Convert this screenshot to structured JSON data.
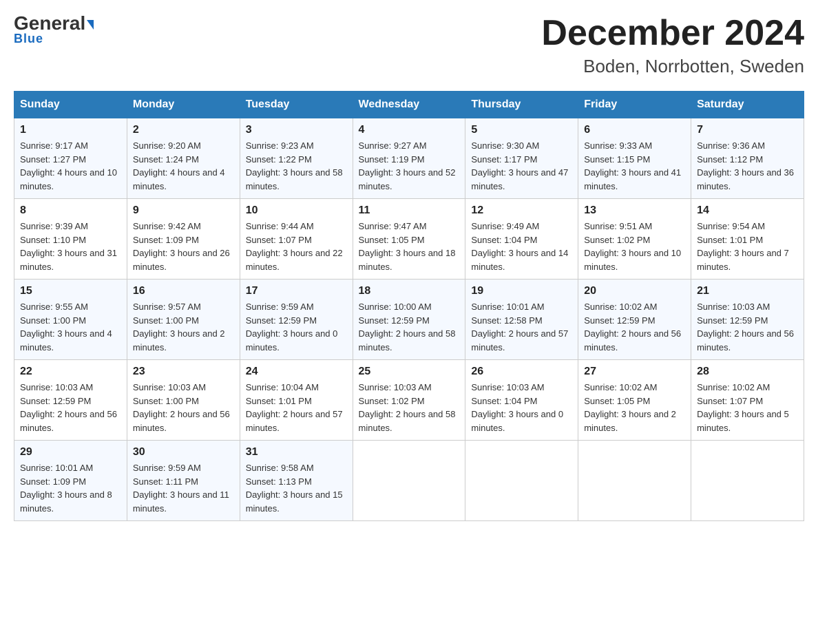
{
  "header": {
    "logo_main": "General",
    "logo_sub": "Blue",
    "month_title": "December 2024",
    "location": "Boden, Norrbotten, Sweden"
  },
  "weekdays": [
    "Sunday",
    "Monday",
    "Tuesday",
    "Wednesday",
    "Thursday",
    "Friday",
    "Saturday"
  ],
  "weeks": [
    [
      {
        "day": "1",
        "sunrise": "9:17 AM",
        "sunset": "1:27 PM",
        "daylight": "4 hours and 10 minutes."
      },
      {
        "day": "2",
        "sunrise": "9:20 AM",
        "sunset": "1:24 PM",
        "daylight": "4 hours and 4 minutes."
      },
      {
        "day": "3",
        "sunrise": "9:23 AM",
        "sunset": "1:22 PM",
        "daylight": "3 hours and 58 minutes."
      },
      {
        "day": "4",
        "sunrise": "9:27 AM",
        "sunset": "1:19 PM",
        "daylight": "3 hours and 52 minutes."
      },
      {
        "day": "5",
        "sunrise": "9:30 AM",
        "sunset": "1:17 PM",
        "daylight": "3 hours and 47 minutes."
      },
      {
        "day": "6",
        "sunrise": "9:33 AM",
        "sunset": "1:15 PM",
        "daylight": "3 hours and 41 minutes."
      },
      {
        "day": "7",
        "sunrise": "9:36 AM",
        "sunset": "1:12 PM",
        "daylight": "3 hours and 36 minutes."
      }
    ],
    [
      {
        "day": "8",
        "sunrise": "9:39 AM",
        "sunset": "1:10 PM",
        "daylight": "3 hours and 31 minutes."
      },
      {
        "day": "9",
        "sunrise": "9:42 AM",
        "sunset": "1:09 PM",
        "daylight": "3 hours and 26 minutes."
      },
      {
        "day": "10",
        "sunrise": "9:44 AM",
        "sunset": "1:07 PM",
        "daylight": "3 hours and 22 minutes."
      },
      {
        "day": "11",
        "sunrise": "9:47 AM",
        "sunset": "1:05 PM",
        "daylight": "3 hours and 18 minutes."
      },
      {
        "day": "12",
        "sunrise": "9:49 AM",
        "sunset": "1:04 PM",
        "daylight": "3 hours and 14 minutes."
      },
      {
        "day": "13",
        "sunrise": "9:51 AM",
        "sunset": "1:02 PM",
        "daylight": "3 hours and 10 minutes."
      },
      {
        "day": "14",
        "sunrise": "9:54 AM",
        "sunset": "1:01 PM",
        "daylight": "3 hours and 7 minutes."
      }
    ],
    [
      {
        "day": "15",
        "sunrise": "9:55 AM",
        "sunset": "1:00 PM",
        "daylight": "3 hours and 4 minutes."
      },
      {
        "day": "16",
        "sunrise": "9:57 AM",
        "sunset": "1:00 PM",
        "daylight": "3 hours and 2 minutes."
      },
      {
        "day": "17",
        "sunrise": "9:59 AM",
        "sunset": "12:59 PM",
        "daylight": "3 hours and 0 minutes."
      },
      {
        "day": "18",
        "sunrise": "10:00 AM",
        "sunset": "12:59 PM",
        "daylight": "2 hours and 58 minutes."
      },
      {
        "day": "19",
        "sunrise": "10:01 AM",
        "sunset": "12:58 PM",
        "daylight": "2 hours and 57 minutes."
      },
      {
        "day": "20",
        "sunrise": "10:02 AM",
        "sunset": "12:59 PM",
        "daylight": "2 hours and 56 minutes."
      },
      {
        "day": "21",
        "sunrise": "10:03 AM",
        "sunset": "12:59 PM",
        "daylight": "2 hours and 56 minutes."
      }
    ],
    [
      {
        "day": "22",
        "sunrise": "10:03 AM",
        "sunset": "12:59 PM",
        "daylight": "2 hours and 56 minutes."
      },
      {
        "day": "23",
        "sunrise": "10:03 AM",
        "sunset": "1:00 PM",
        "daylight": "2 hours and 56 minutes."
      },
      {
        "day": "24",
        "sunrise": "10:04 AM",
        "sunset": "1:01 PM",
        "daylight": "2 hours and 57 minutes."
      },
      {
        "day": "25",
        "sunrise": "10:03 AM",
        "sunset": "1:02 PM",
        "daylight": "2 hours and 58 minutes."
      },
      {
        "day": "26",
        "sunrise": "10:03 AM",
        "sunset": "1:04 PM",
        "daylight": "3 hours and 0 minutes."
      },
      {
        "day": "27",
        "sunrise": "10:02 AM",
        "sunset": "1:05 PM",
        "daylight": "3 hours and 2 minutes."
      },
      {
        "day": "28",
        "sunrise": "10:02 AM",
        "sunset": "1:07 PM",
        "daylight": "3 hours and 5 minutes."
      }
    ],
    [
      {
        "day": "29",
        "sunrise": "10:01 AM",
        "sunset": "1:09 PM",
        "daylight": "3 hours and 8 minutes."
      },
      {
        "day": "30",
        "sunrise": "9:59 AM",
        "sunset": "1:11 PM",
        "daylight": "3 hours and 11 minutes."
      },
      {
        "day": "31",
        "sunrise": "9:58 AM",
        "sunset": "1:13 PM",
        "daylight": "3 hours and 15 minutes."
      },
      null,
      null,
      null,
      null
    ]
  ]
}
